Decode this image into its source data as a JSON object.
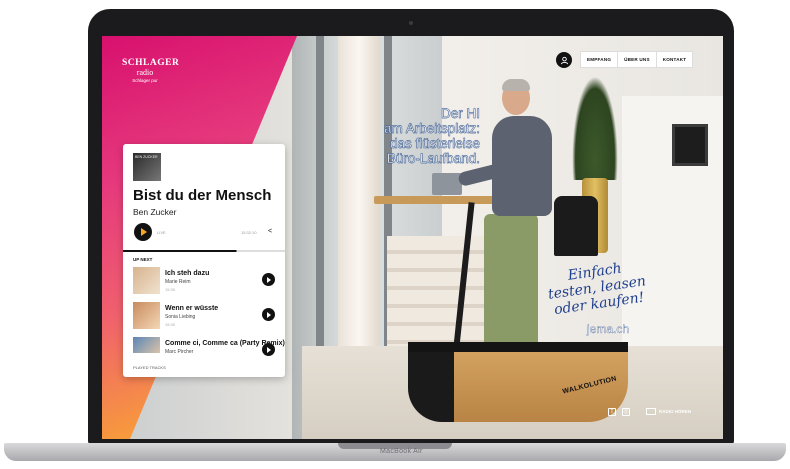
{
  "site": {
    "logo": {
      "line1": "SCHLAGER",
      "line2": "radio",
      "line3": "Schlager pur"
    },
    "nav": [
      "EMPFANG",
      "ÜBER UNS",
      "KONTAKT"
    ],
    "headline": [
      "Der HI",
      "am Arbeitsplatz:",
      "das flüsterleise",
      "Büro-Laufband."
    ],
    "cta": [
      "Einfach",
      "testen, leasen",
      "oder kaufen!"
    ],
    "domain": "jema.ch",
    "treadmill_brand": "WALKOLUTION",
    "social_button": "RADIO HÖREN"
  },
  "player": {
    "cover_caption": "BEN ZUCKER",
    "current": {
      "title": "Bist du der Mensch",
      "artist": "Ben Zucker",
      "live_label": "LIVE",
      "time": "15:32:10"
    },
    "up_next_label": "UP NEXT",
    "queue": [
      {
        "title": "Ich steh dazu",
        "artist": "Marie Reim",
        "time": "15:35"
      },
      {
        "title": "Wenn er wüsste",
        "artist": "Sonia Liebing",
        "time": "15:39"
      },
      {
        "title": "Comme ci, Comme ca (Party Remix)",
        "artist": "Marc Pircher",
        "time": ""
      }
    ],
    "played_label": "PLAYED TRACKS"
  },
  "device": {
    "model": "MacBook Air"
  },
  "colors": {
    "brand_pink": "#d8106e",
    "brand_orange": "#f79a3c",
    "cta_blue": "#1f3f8f"
  }
}
